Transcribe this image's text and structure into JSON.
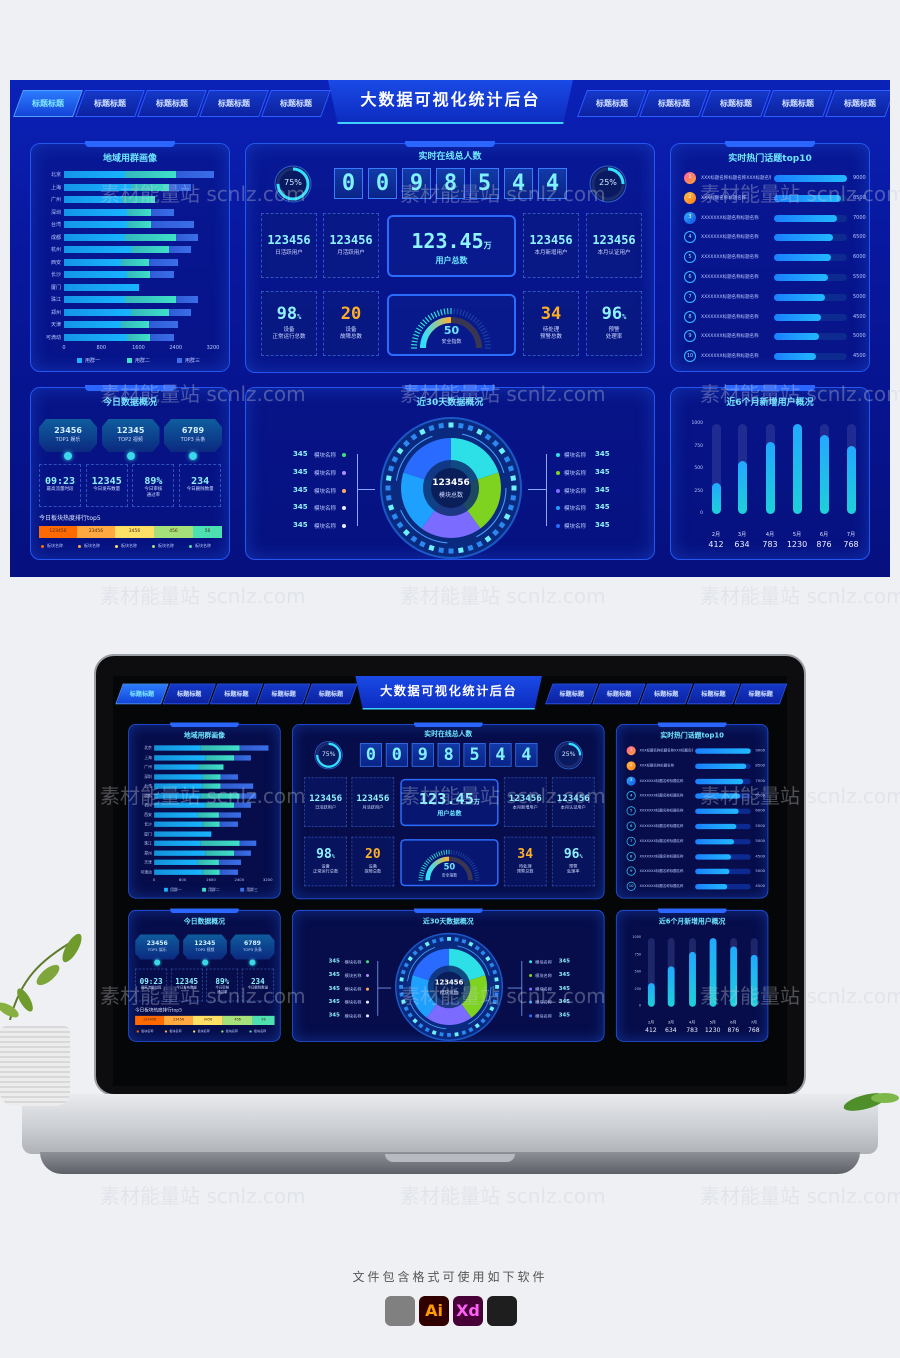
{
  "header": {
    "title": "大数据可视化统计后台",
    "left_tabs": [
      "标题标题",
      "标题标题",
      "标题标题",
      "标题标题",
      "标题标题"
    ],
    "right_tabs": [
      "标题标题",
      "标题标题",
      "标题标题",
      "标题标题",
      "标题标题"
    ],
    "active_tab": 0
  },
  "region_panel": {
    "title": "地域用群画像",
    "legend": [
      "用群一",
      "用群二",
      "用群三"
    ],
    "colors": [
      "#18b4ff",
      "#3fe0c8",
      "#3a6ee8"
    ],
    "axis_ticks": [
      "0",
      "800",
      "1600",
      "2400",
      "3200"
    ],
    "rows": [
      {
        "city": "北京",
        "values": [
          1300,
          1100,
          820
        ]
      },
      {
        "city": "上海",
        "values": [
          1435,
          810,
          485
        ]
      },
      {
        "city": "广州",
        "values": [
          1250,
          700,
          0
        ]
      },
      {
        "city": "深圳",
        "values": [
          1350,
          510,
          510
        ]
      },
      {
        "city": "台湾",
        "values": [
          1350,
          510,
          930
        ]
      },
      {
        "city": "成都",
        "values": [
          1300,
          1100,
          480
        ]
      },
      {
        "city": "杭州",
        "values": [
          1440,
          810,
          480
        ]
      },
      {
        "city": "西安",
        "values": [
          1225,
          610,
          610
        ]
      },
      {
        "city": "长沙",
        "values": [
          1350,
          500,
          510
        ]
      },
      {
        "city": "厦门",
        "values": [
          1600,
          0,
          0
        ]
      },
      {
        "city": "珠江",
        "values": [
          1300,
          1100,
          480
        ]
      },
      {
        "city": "郑州",
        "values": [
          1440,
          810,
          480
        ]
      },
      {
        "city": "天津",
        "values": [
          1225,
          610,
          610
        ]
      },
      {
        "city": "可滴动",
        "values": [
          1350,
          500,
          510
        ]
      }
    ]
  },
  "online_panel": {
    "title": "实时在线总人数",
    "digits": [
      "0",
      "0",
      "9",
      "8",
      "5",
      "4",
      "4"
    ],
    "ring_left": {
      "value": "75%",
      "fraction": 0.75
    },
    "ring_right": {
      "value": "25%",
      "fraction": 0.25
    },
    "stats_row1": [
      {
        "value": "123456",
        "label": "日活跃用户"
      },
      {
        "value": "123456",
        "label": "月活跃用户"
      },
      {
        "value": "123456",
        "label": "本月新增用户"
      },
      {
        "value": "123456",
        "label": "本月认证用户"
      }
    ],
    "total": {
      "value": "123.45",
      "unit": "万",
      "label": "用户总数"
    },
    "stats_row2": [
      {
        "value": "98",
        "unit": "%",
        "label": "设备\n正常运行总数",
        "color": "#8ff3ff"
      },
      {
        "value": "20",
        "unit": "",
        "label": "设备\n故障总数",
        "color": "#ffae2a"
      },
      {
        "value": "34",
        "unit": "",
        "label": "待处理\n预警总数",
        "color": "#ffae2a"
      },
      {
        "value": "96",
        "unit": "%",
        "label": "预警\n处理率",
        "color": "#8ff3ff"
      }
    ],
    "gauge": {
      "value": "50",
      "label": "安全指数",
      "fraction": 0.5
    }
  },
  "topics_panel": {
    "title": "实时热门话题top10",
    "items": [
      {
        "rank": "1",
        "name": "XXX标题名称标题名称XXX标题名称标题名称XXX标",
        "value": "9000",
        "level": 1.0
      },
      {
        "rank": "2",
        "name": "XXX标题名称标题名称",
        "value": "8500",
        "level": 0.92
      },
      {
        "rank": "3",
        "name": "XXXXXXX标题名称标题名称",
        "value": "7000",
        "level": 0.86
      },
      {
        "rank": "4",
        "name": "XXXXXXX标题名称标题名称",
        "value": "6500",
        "level": 0.81
      },
      {
        "rank": "5",
        "name": "XXXXXXX标题名称标题名称",
        "value": "6000",
        "level": 0.78
      },
      {
        "rank": "6",
        "name": "XXXXXXX标题名称标题名称",
        "value": "5500",
        "level": 0.74
      },
      {
        "rank": "7",
        "name": "XXXXXXX标题名称标题名称",
        "value": "5000",
        "level": 0.7
      },
      {
        "rank": "8",
        "name": "XXXXXXX标题名称标题名称",
        "value": "4500",
        "level": 0.65
      },
      {
        "rank": "9",
        "name": "XXXXXXX标题名称标题名称",
        "value": "5000",
        "level": 0.62
      },
      {
        "rank": "10",
        "name": "XXXXXXX标题名称标题名称",
        "value": "4500",
        "level": 0.58
      }
    ]
  },
  "today_panel": {
    "title": "今日数据概况",
    "top3": [
      {
        "value": "23456",
        "label": "TOP1 娱乐"
      },
      {
        "value": "12345",
        "label": "TOP2 视频"
      },
      {
        "value": "6789",
        "label": "TOP3 头条"
      }
    ],
    "stats": [
      {
        "value": "09:23",
        "label": "最高流量时段"
      },
      {
        "value": "12345",
        "label": "今日发布数量"
      },
      {
        "value": "89%",
        "label": "今日审核\n通过率"
      },
      {
        "value": "234",
        "label": "今日删除数量"
      }
    ],
    "rank_title": "今日板块热度排行top5",
    "rank": [
      {
        "value": "123456",
        "color": "#ff6a00",
        "name": "板块名称"
      },
      {
        "value": "23456",
        "color": "#ffa940",
        "name": "板块名称"
      },
      {
        "value": "3456",
        "color": "#ffe066",
        "name": "板块名称"
      },
      {
        "value": "456",
        "color": "#a6e07a",
        "name": "板块名称"
      },
      {
        "value": "56",
        "color": "#4de0b0",
        "name": "板块名称"
      }
    ]
  },
  "month_panel": {
    "title": "近30天数据概况",
    "center_value": "123456",
    "center_label": "模块总数",
    "left_items": [
      {
        "value": "345",
        "name": "模块名称",
        "color": "#3fe07a"
      },
      {
        "value": "345",
        "name": "模块名称",
        "color": "#b08cff"
      },
      {
        "value": "345",
        "name": "模块名称",
        "color": "#ffab5a"
      },
      {
        "value": "345",
        "name": "模块名称",
        "color": "#e8ecff"
      },
      {
        "value": "345",
        "name": "模块名称",
        "color": "#e8ecff"
      }
    ],
    "right_items": [
      {
        "value": "345",
        "name": "模块名称",
        "color": "#2de0e8"
      },
      {
        "value": "345",
        "name": "模块名称",
        "color": "#7ed321"
      },
      {
        "value": "345",
        "name": "模块名称",
        "color": "#7b6cff"
      },
      {
        "value": "345",
        "name": "模块名称",
        "color": "#1ea0ff"
      },
      {
        "value": "345",
        "name": "模块名称",
        "color": "#2a6bff"
      }
    ]
  },
  "chart_data": {
    "type": "bar",
    "title": "近6个月新增用户概况",
    "categories": [
      "2月",
      "3月",
      "4月",
      "5月",
      "6月",
      "7月"
    ],
    "values": [
      412,
      634,
      783,
      1230,
      876,
      768
    ],
    "bar_levels": [
      340,
      590,
      800,
      1000,
      880,
      760
    ],
    "ylim": [
      0,
      1000
    ],
    "yticks": [
      "1000",
      "750",
      "500",
      "250",
      "0"
    ],
    "grid": false
  },
  "footer": {
    "caption": "文件包含格式可使用如下软件",
    "software": [
      {
        "icon": "sketch-icon",
        "label": "",
        "color": "#f7b500"
      },
      {
        "icon": "illustrator-icon",
        "label": "Ai",
        "color": "#ff9a00"
      },
      {
        "icon": "xd-icon",
        "label": "Xd",
        "color": "#ff61f6"
      },
      {
        "icon": "figma-icon",
        "label": "",
        "color": "#1e1e1e"
      }
    ]
  },
  "watermark": "素材能量站 scnlz.com"
}
